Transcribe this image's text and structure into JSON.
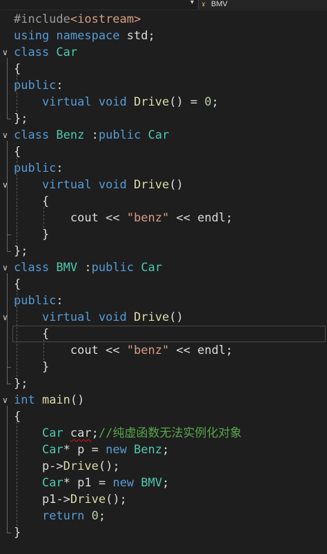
{
  "navigation_bar": {
    "dropdown_arrow": "▾",
    "class_icon": "ɤ",
    "selected_class": "BMV"
  },
  "code_lines": [
    {
      "tokens": [
        {
          "text": "#include",
          "cls": "pp"
        },
        {
          "text": "<iostream>",
          "cls": "ppstr"
        }
      ]
    },
    {
      "tokens": [
        {
          "text": "using namespace ",
          "cls": "kw"
        },
        {
          "text": "std;",
          "cls": "plain"
        }
      ]
    },
    {
      "tokens": [
        {
          "text": "class ",
          "cls": "kw"
        },
        {
          "text": "Car",
          "cls": "type"
        }
      ],
      "fold": "expanded"
    },
    {
      "tokens": [
        {
          "text": "{",
          "cls": "plain"
        }
      ]
    },
    {
      "tokens": [
        {
          "text": "public",
          "cls": "kw"
        },
        {
          "text": ":",
          "cls": "plain"
        }
      ]
    },
    {
      "tokens": [
        {
          "text": "    ",
          "cls": "plain"
        },
        {
          "text": "virtual void ",
          "cls": "kw"
        },
        {
          "text": "Drive",
          "cls": "fn"
        },
        {
          "text": "() = ",
          "cls": "plain"
        },
        {
          "text": "0",
          "cls": "num"
        },
        {
          "text": ";",
          "cls": "plain"
        }
      ]
    },
    {
      "tokens": [
        {
          "text": "};",
          "cls": "plain"
        }
      ]
    },
    {
      "tokens": [
        {
          "text": "class ",
          "cls": "kw"
        },
        {
          "text": "Benz ",
          "cls": "type"
        },
        {
          "text": ":",
          "cls": "plain"
        },
        {
          "text": "public ",
          "cls": "kw"
        },
        {
          "text": "Car",
          "cls": "type"
        }
      ],
      "fold": "expanded"
    },
    {
      "tokens": [
        {
          "text": "{",
          "cls": "plain"
        }
      ]
    },
    {
      "tokens": [
        {
          "text": "public",
          "cls": "kw"
        },
        {
          "text": ":",
          "cls": "plain"
        }
      ]
    },
    {
      "tokens": [
        {
          "text": "    ",
          "cls": "plain"
        },
        {
          "text": "virtual void ",
          "cls": "kw"
        },
        {
          "text": "Drive",
          "cls": "fn"
        },
        {
          "text": "()",
          "cls": "plain"
        }
      ],
      "fold": "expanded"
    },
    {
      "tokens": [
        {
          "text": "    {",
          "cls": "plain"
        }
      ]
    },
    {
      "tokens": [
        {
          "text": "        cout << ",
          "cls": "plain"
        },
        {
          "text": "\"benz\"",
          "cls": "str"
        },
        {
          "text": " << endl;",
          "cls": "plain"
        }
      ]
    },
    {
      "tokens": [
        {
          "text": "    }",
          "cls": "plain"
        }
      ]
    },
    {
      "tokens": [
        {
          "text": "};",
          "cls": "plain"
        }
      ]
    },
    {
      "tokens": [
        {
          "text": "class ",
          "cls": "kw"
        },
        {
          "text": "BMV ",
          "cls": "type"
        },
        {
          "text": ":",
          "cls": "plain"
        },
        {
          "text": "public ",
          "cls": "kw"
        },
        {
          "text": "Car",
          "cls": "type"
        }
      ],
      "fold": "expanded"
    },
    {
      "tokens": [
        {
          "text": "{",
          "cls": "plain"
        }
      ]
    },
    {
      "tokens": [
        {
          "text": "public",
          "cls": "kw"
        },
        {
          "text": ":",
          "cls": "plain"
        }
      ]
    },
    {
      "tokens": [
        {
          "text": "    ",
          "cls": "plain"
        },
        {
          "text": "virtual void ",
          "cls": "kw"
        },
        {
          "text": "Drive",
          "cls": "fn"
        },
        {
          "text": "()",
          "cls": "plain"
        }
      ],
      "fold": "expanded"
    },
    {
      "tokens": [
        {
          "text": "    {",
          "cls": "plain"
        }
      ],
      "current": true
    },
    {
      "tokens": [
        {
          "text": "        cout << ",
          "cls": "plain"
        },
        {
          "text": "\"benz\"",
          "cls": "str"
        },
        {
          "text": " << endl;",
          "cls": "plain"
        }
      ]
    },
    {
      "tokens": [
        {
          "text": "    }",
          "cls": "plain"
        }
      ]
    },
    {
      "tokens": [
        {
          "text": "};",
          "cls": "plain"
        }
      ]
    },
    {
      "tokens": [
        {
          "text": "int ",
          "cls": "kw"
        },
        {
          "text": "main",
          "cls": "fn"
        },
        {
          "text": "()",
          "cls": "plain"
        }
      ],
      "fold": "expanded"
    },
    {
      "tokens": [
        {
          "text": "{",
          "cls": "plain"
        }
      ]
    },
    {
      "tokens": [
        {
          "text": "    ",
          "cls": "plain"
        },
        {
          "text": "Car ",
          "cls": "type"
        },
        {
          "text": "car",
          "cls": "plain",
          "error": true
        },
        {
          "text": ";",
          "cls": "plain"
        },
        {
          "text": "//纯虚函数无法实例化对象",
          "cls": "com"
        }
      ]
    },
    {
      "tokens": [
        {
          "text": "    ",
          "cls": "plain"
        },
        {
          "text": "Car",
          "cls": "type"
        },
        {
          "text": "* p = ",
          "cls": "plain"
        },
        {
          "text": "new ",
          "cls": "kw"
        },
        {
          "text": "Benz",
          "cls": "type"
        },
        {
          "text": ";",
          "cls": "plain"
        }
      ]
    },
    {
      "tokens": [
        {
          "text": "    p->",
          "cls": "plain"
        },
        {
          "text": "Drive",
          "cls": "fn"
        },
        {
          "text": "();",
          "cls": "plain"
        }
      ]
    },
    {
      "tokens": [
        {
          "text": "    ",
          "cls": "plain"
        },
        {
          "text": "Car",
          "cls": "type"
        },
        {
          "text": "* p1 = ",
          "cls": "plain"
        },
        {
          "text": "new ",
          "cls": "kw"
        },
        {
          "text": "BMV",
          "cls": "type"
        },
        {
          "text": ";",
          "cls": "plain"
        }
      ]
    },
    {
      "tokens": [
        {
          "text": "    p1->",
          "cls": "plain"
        },
        {
          "text": "Drive",
          "cls": "fn"
        },
        {
          "text": "();",
          "cls": "plain"
        }
      ]
    },
    {
      "tokens": [
        {
          "text": "    ",
          "cls": "plain"
        },
        {
          "text": "return ",
          "cls": "kw"
        },
        {
          "text": "0",
          "cls": "num"
        },
        {
          "text": ";",
          "cls": "plain"
        }
      ]
    },
    {
      "tokens": [
        {
          "text": "}",
          "cls": "plain"
        }
      ]
    }
  ],
  "fold_icon": "∨"
}
